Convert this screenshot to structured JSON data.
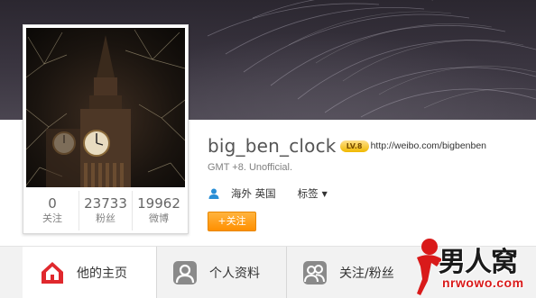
{
  "profile": {
    "username": "big_ben_clock",
    "level_badge": "LV.8",
    "url": "http://weibo.com/bigbenben",
    "bio": "GMT +8. Unofficial.",
    "location": "海外 英国",
    "tag_label": "标签",
    "follow_button": "+关注"
  },
  "stats": [
    {
      "value": "0",
      "label": "关注"
    },
    {
      "value": "23733",
      "label": "粉丝"
    },
    {
      "value": "19962",
      "label": "微博"
    }
  ],
  "tabs": [
    {
      "label": "他的主页",
      "icon": "home-icon",
      "active": true
    },
    {
      "label": "个人资料",
      "icon": "profile-icon",
      "active": false
    },
    {
      "label": "关注/粉丝",
      "icon": "followers-icon",
      "active": false
    }
  ],
  "watermark": {
    "main": "男人窝",
    "sub": "nrwowo.com"
  },
  "colors": {
    "accent_orange": "#ff9a1a",
    "home_icon_red": "#e0282d",
    "tab_icon_gray": "#8a8a8a",
    "level_gold": "#f0b800",
    "watermark_red": "#d91a1a"
  }
}
